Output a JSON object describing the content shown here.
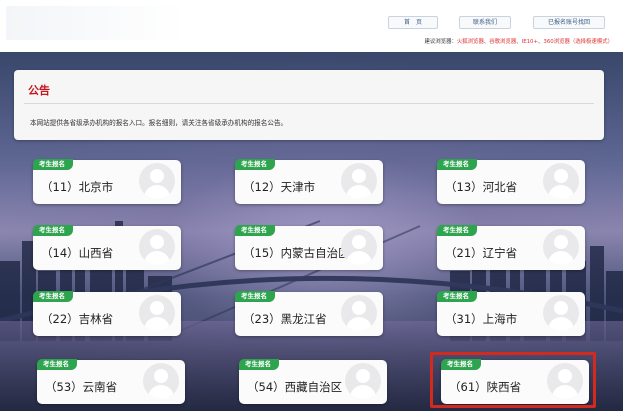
{
  "header": {
    "nav": [
      "首　页",
      "联系我们",
      "已报名账号找回"
    ],
    "browser_tip": {
      "prefix": "建议浏览器：",
      "b1": "火狐浏览器",
      "b2": "谷歌浏览器",
      "b3": "IE10+",
      "b4": "360浏览器（选择极速模式）",
      "sep": "、"
    }
  },
  "notice": {
    "title": "公告",
    "text": "本网站提供各省级承办机构的报名入口。报名细则，请关注各省级承办机构的报名公告。"
  },
  "cards": [
    {
      "badge": "考生报名",
      "label": "（11）北京市"
    },
    {
      "badge": "考生报名",
      "label": "（12）天津市"
    },
    {
      "badge": "考生报名",
      "label": "（13）河北省"
    },
    {
      "badge": "考生报名",
      "label": "（14）山西省"
    },
    {
      "badge": "考生报名",
      "label": "（15）内蒙古自治区"
    },
    {
      "badge": "考生报名",
      "label": "（21）辽宁省"
    },
    {
      "badge": "考生报名",
      "label": "（22）吉林省"
    },
    {
      "badge": "考生报名",
      "label": "（23）黑龙江省"
    },
    {
      "badge": "考生报名",
      "label": "（31）上海市"
    },
    {
      "badge": "考生报名",
      "label": "（53）云南省"
    },
    {
      "badge": "考生报名",
      "label": "（54）西藏自治区"
    },
    {
      "badge": "考生报名",
      "label": "（61）陕西省"
    }
  ],
  "colors": {
    "accent": "#c4161c",
    "badge": "#2ea44f",
    "highlight": "#d42a1e"
  },
  "icons": {
    "card_avatar": "user-placeholder-icon"
  }
}
